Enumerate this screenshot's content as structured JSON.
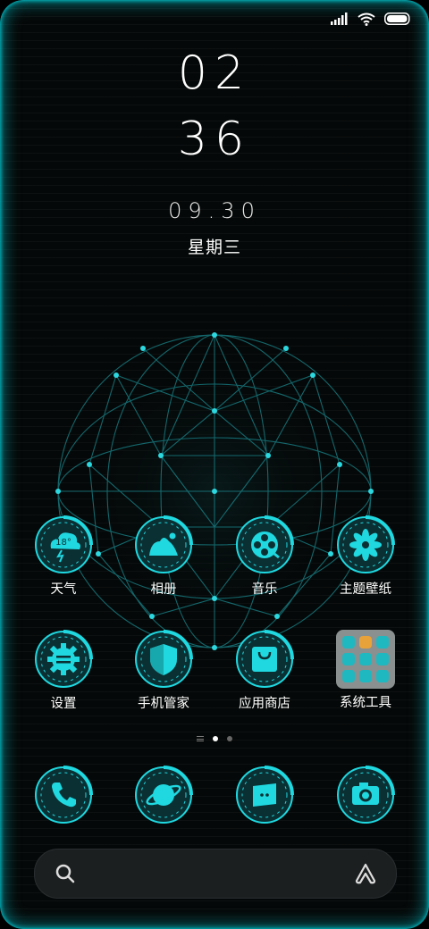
{
  "colors": {
    "accent": "#1fd8e0",
    "accent_dark": "#0a4a50",
    "background": "#050808"
  },
  "status_bar": {
    "icons": [
      "signal-icon",
      "wifi-icon",
      "battery-icon"
    ]
  },
  "lockclock": {
    "hour": "02",
    "minute": "36",
    "date": "09.30",
    "weekday": "星期三"
  },
  "apps_row1": [
    {
      "label": "天气",
      "icon": "weather-icon",
      "badge": "18°"
    },
    {
      "label": "相册",
      "icon": "gallery-icon"
    },
    {
      "label": "音乐",
      "icon": "music-icon"
    },
    {
      "label": "主题壁纸",
      "icon": "themes-icon"
    }
  ],
  "apps_row2": [
    {
      "label": "设置",
      "icon": "settings-icon"
    },
    {
      "label": "手机管家",
      "icon": "security-icon"
    },
    {
      "label": "应用商店",
      "icon": "appstore-icon"
    },
    {
      "label": "系统工具",
      "icon": "folder-icon"
    }
  ],
  "page_indicator": {
    "pages": 2,
    "current": 1
  },
  "dock": [
    {
      "icon": "phone-icon"
    },
    {
      "icon": "browser-icon"
    },
    {
      "icon": "messages-icon"
    },
    {
      "icon": "camera-icon"
    }
  ],
  "search": {
    "icons": [
      "search-icon",
      "assistant-icon"
    ]
  }
}
